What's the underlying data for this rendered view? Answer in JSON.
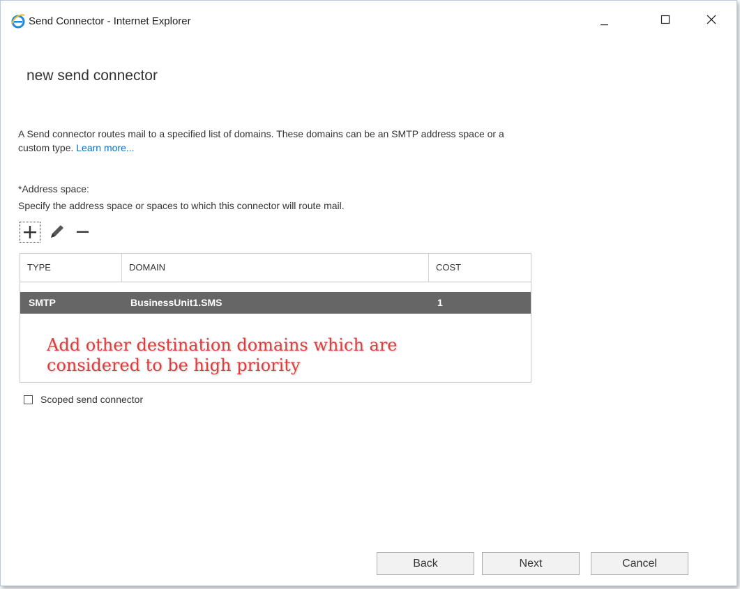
{
  "window": {
    "title": "Send Connector - Internet Explorer",
    "icon": "internet-explorer-icon",
    "controls": {
      "minimize": "minimize-icon",
      "maximize": "maximize-icon",
      "close": "close-icon"
    }
  },
  "page": {
    "title": "new send connector",
    "description": "A Send connector routes mail to a specified list of domains. These domains can be an SMTP address space or a custom type.",
    "learn_more": "Learn more..."
  },
  "address_space": {
    "label": "*Address space:",
    "help": "Specify the address space or spaces to which this connector will route mail.",
    "toolbar": {
      "add": "plus-icon",
      "edit": "pencil-icon",
      "remove": "minus-icon"
    },
    "columns": {
      "type": "TYPE",
      "domain": "DOMAIN",
      "cost": "COST"
    },
    "rows": [
      {
        "type": "SMTP",
        "domain": "BusinessUnit1.SMS",
        "cost": "1"
      }
    ],
    "annotation": "Add other destination domains which are considered to be high priority"
  },
  "scoped": {
    "label": "Scoped send connector",
    "checked": false
  },
  "buttons": {
    "back": "Back",
    "next": "Next",
    "cancel": "Cancel"
  },
  "colors": {
    "accent": "#0072c6",
    "selected_row": "#666666",
    "annotation": "#e03c3c"
  }
}
